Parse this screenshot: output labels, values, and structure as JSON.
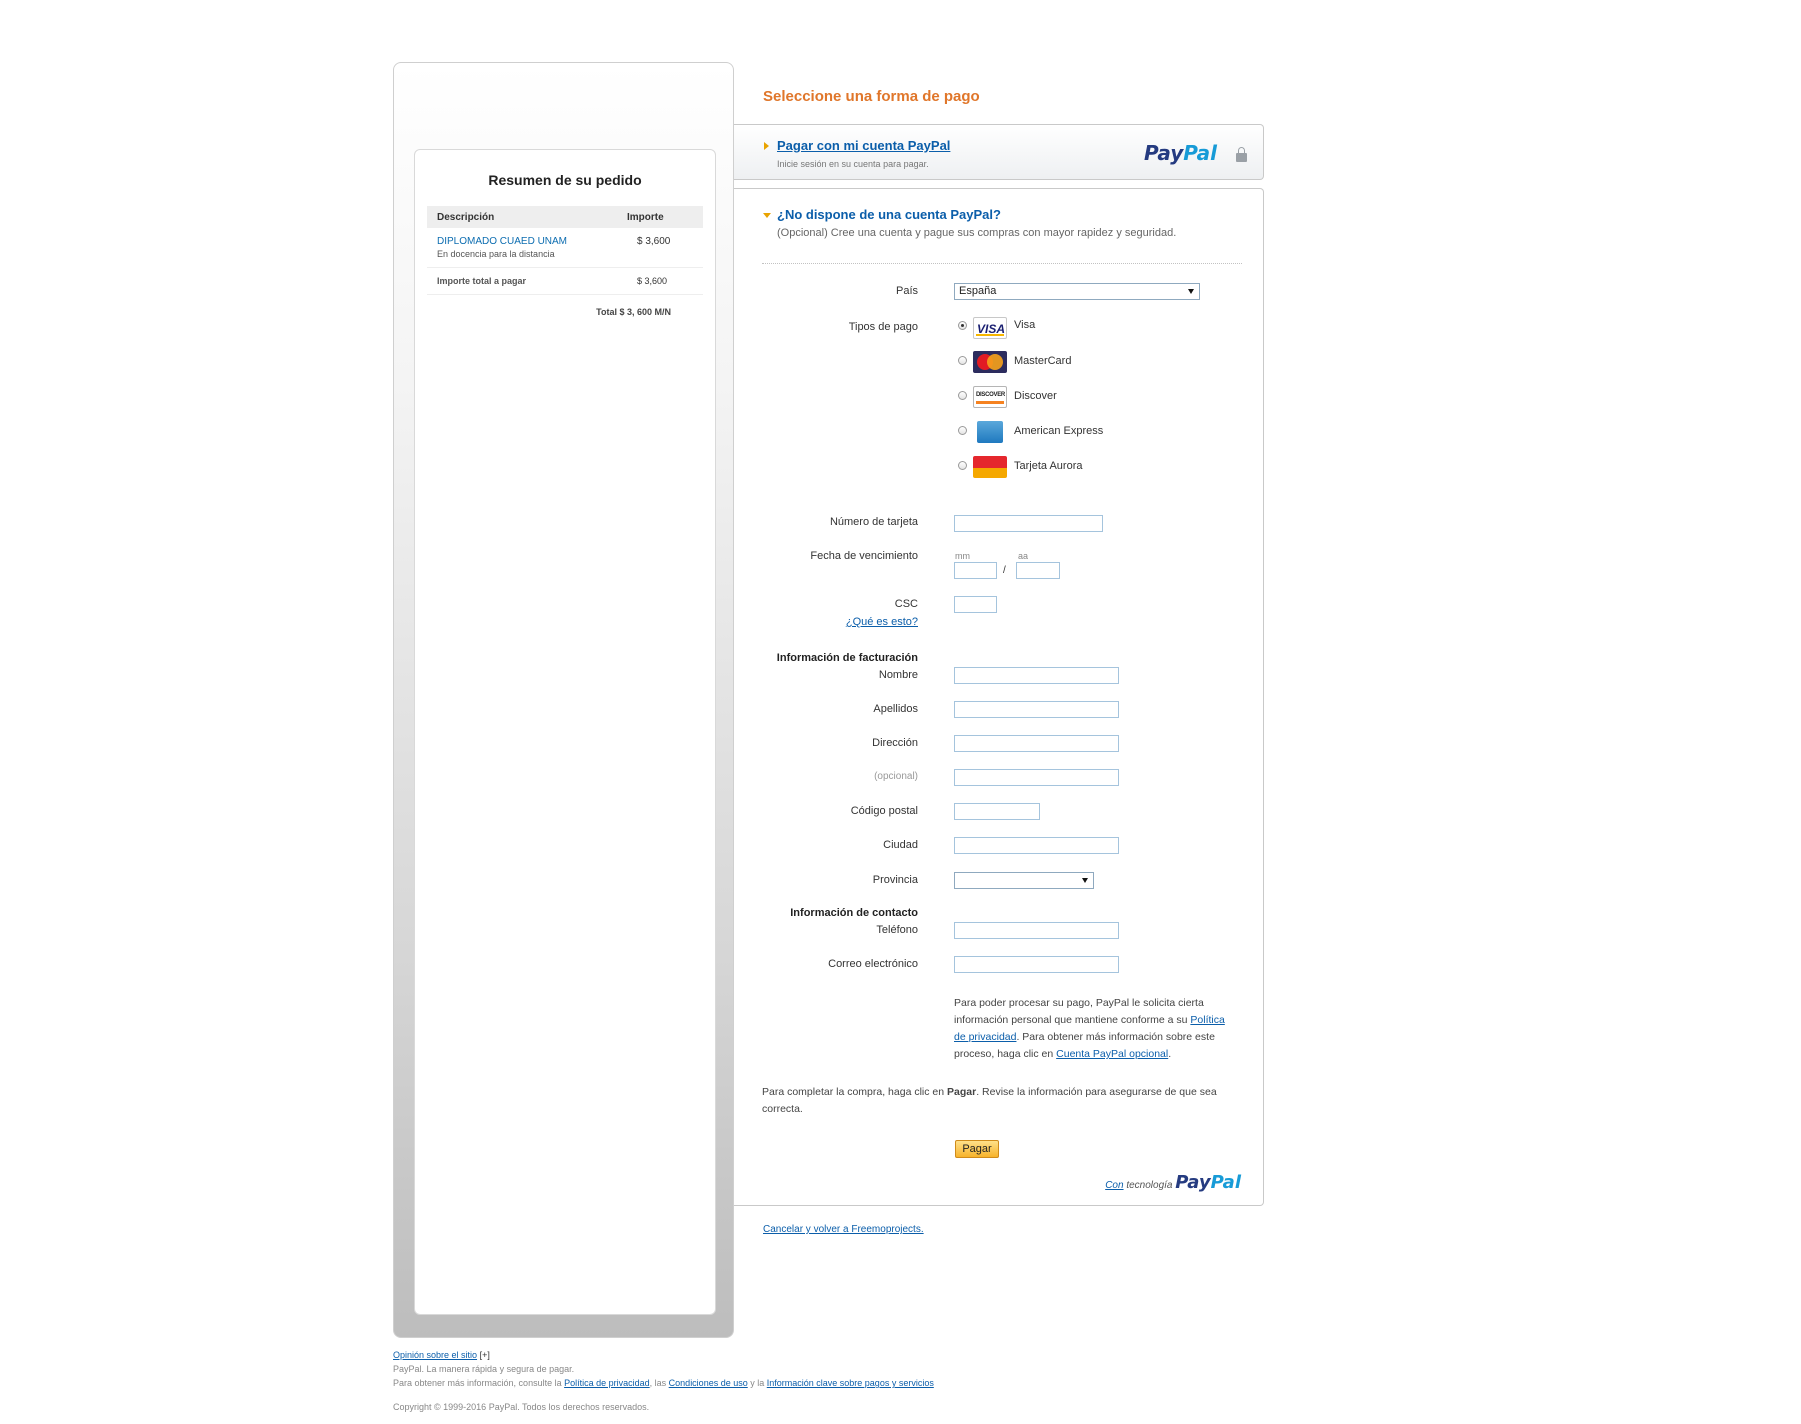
{
  "summary": {
    "title": "Resumen de su pedido",
    "col_desc": "Descripción",
    "col_amount": "Importe",
    "item_name": "DIPLOMADO CUAED UNAM",
    "item_desc": "En docencia para la distancia",
    "item_amount": "$ 3,600",
    "total_label": "Importe total a pagar",
    "total_amount": "$ 3,600",
    "grand_total": "Total $ 3, 600 M/N"
  },
  "header": {
    "title": "Seleccione una forma de pago"
  },
  "login": {
    "link": "Pagar con mi cuenta PayPal",
    "sub": "Inicie sesión en su cuenta para pagar.",
    "logo_part1": "Pay",
    "logo_part2": "Pal"
  },
  "guest": {
    "title": "¿No dispone de una cuenta PayPal?",
    "sub": "(Opcional) Cree una cuenta y pague sus compras con mayor rapidez y seguridad."
  },
  "form": {
    "country_label": "País",
    "country_value": "España",
    "payment_types_label": "Tipos de pago",
    "cards": [
      {
        "label": "Visa",
        "selected": true,
        "icon": "visa-icon"
      },
      {
        "label": "MasterCard",
        "selected": false,
        "icon": "mastercard-icon"
      },
      {
        "label": "Discover",
        "selected": false,
        "icon": "discover-icon"
      },
      {
        "label": "American Express",
        "selected": false,
        "icon": "amex-icon"
      },
      {
        "label": "Tarjeta Aurora",
        "selected": false,
        "icon": "aurora-icon"
      }
    ],
    "card_number_label": "Número de tarjeta",
    "expiry_label": "Fecha de vencimiento",
    "expiry_mm": "mm",
    "expiry_yy": "aa",
    "expiry_sep": "/",
    "csc_label": "CSC",
    "csc_help": "¿Qué es esto?",
    "billing_heading": "Información de facturación",
    "first_name_label": "Nombre",
    "last_name_label": "Apellidos",
    "address_label": "Dirección",
    "address2_label": "(opcional)",
    "zip_label": "Código postal",
    "city_label": "Ciudad",
    "province_label": "Provincia",
    "contact_heading": "Información de contacto",
    "phone_label": "Teléfono",
    "email_label": "Correo electrónico"
  },
  "notice": {
    "p1": "Para poder procesar su pago, PayPal le solicita cierta información personal que mantiene conforme a su ",
    "privacy_link": "Política de privacidad",
    "p2": ". Para obtener más información sobre este proceso, haga clic en ",
    "account_link": "Cuenta PayPal opcional",
    "p3": "."
  },
  "final": {
    "t1": "Para completar la compra, haga clic en ",
    "bold": "Pagar",
    "t2": ". Revise la información para asegurarse de que sea correcta."
  },
  "pay_button": "Pagar",
  "powered": {
    "con": "Con",
    "tecnologia": "tecnología",
    "logo_part1": "Pay",
    "logo_part2": "Pal"
  },
  "cancel_link": "Cancelar y volver a Freemoprojects.",
  "footer": {
    "feedback_link": "Opinión sobre el sitio",
    "feedback_plus": "[+]",
    "tagline": "PayPal. La manera rápida y segura de pagar.",
    "info_prefix": "Para obtener más información, consulte la ",
    "privacy": "Política de privacidad",
    "comma": ", las ",
    "terms": "Condiciones de uso",
    "and": " y la ",
    "key_info": "Información clave sobre pagos y servicios",
    "copyright": "Copyright © 1999-2016 PayPal. Todos los derechos reservados."
  }
}
